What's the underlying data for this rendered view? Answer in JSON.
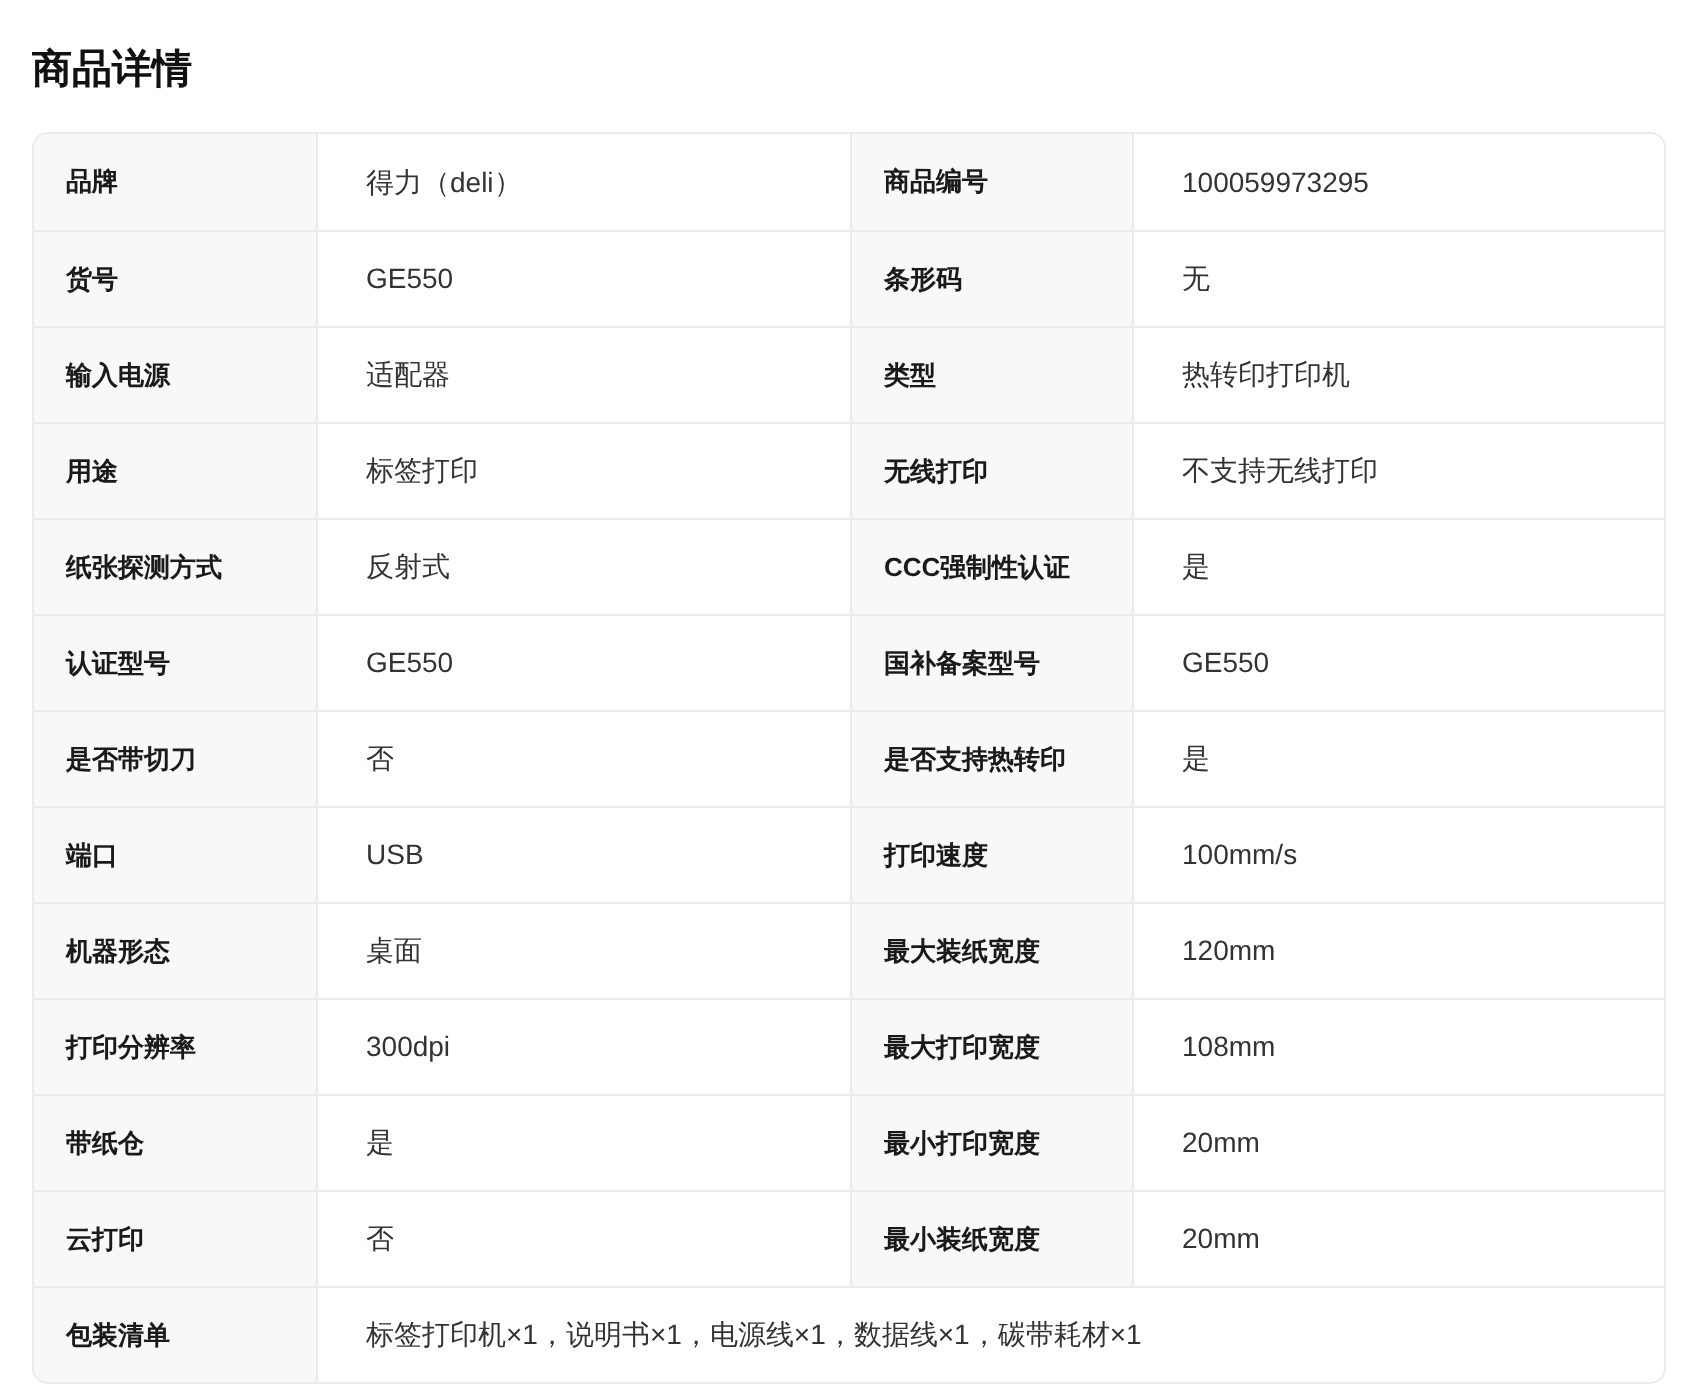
{
  "title": "商品详情",
  "rows": [
    {
      "cells": [
        {
          "label": "品牌",
          "value": "得力（deli）"
        },
        {
          "label": "商品编号",
          "value": "100059973295"
        }
      ]
    },
    {
      "cells": [
        {
          "label": "货号",
          "value": "GE550"
        },
        {
          "label": "条形码",
          "value": "无"
        }
      ]
    },
    {
      "cells": [
        {
          "label": "输入电源",
          "value": "适配器"
        },
        {
          "label": "类型",
          "value": "热转印打印机"
        }
      ]
    },
    {
      "cells": [
        {
          "label": "用途",
          "value": "标签打印"
        },
        {
          "label": "无线打印",
          "value": "不支持无线打印"
        }
      ]
    },
    {
      "cells": [
        {
          "label": "纸张探测方式",
          "value": "反射式"
        },
        {
          "label": "CCC强制性认证",
          "value": "是"
        }
      ]
    },
    {
      "cells": [
        {
          "label": "认证型号",
          "value": "GE550"
        },
        {
          "label": "国补备案型号",
          "value": "GE550"
        }
      ]
    },
    {
      "cells": [
        {
          "label": "是否带切刀",
          "value": "否"
        },
        {
          "label": "是否支持热转印",
          "value": "是"
        }
      ]
    },
    {
      "cells": [
        {
          "label": "端口",
          "value": "USB"
        },
        {
          "label": "打印速度",
          "value": "100mm/s"
        }
      ]
    },
    {
      "cells": [
        {
          "label": "机器形态",
          "value": "桌面"
        },
        {
          "label": "最大装纸宽度",
          "value": "120mm"
        }
      ]
    },
    {
      "cells": [
        {
          "label": "打印分辨率",
          "value": "300dpi"
        },
        {
          "label": "最大打印宽度",
          "value": "108mm"
        }
      ]
    },
    {
      "cells": [
        {
          "label": "带纸仓",
          "value": "是"
        },
        {
          "label": "最小打印宽度",
          "value": "20mm"
        }
      ]
    },
    {
      "cells": [
        {
          "label": "云打印",
          "value": "否"
        },
        {
          "label": "最小装纸宽度",
          "value": "20mm"
        }
      ]
    },
    {
      "cells": [
        {
          "label": "包装清单",
          "value": "标签打印机×1，说明书×1，电源线×1，数据线×1，碳带耗材×1"
        }
      ]
    }
  ]
}
